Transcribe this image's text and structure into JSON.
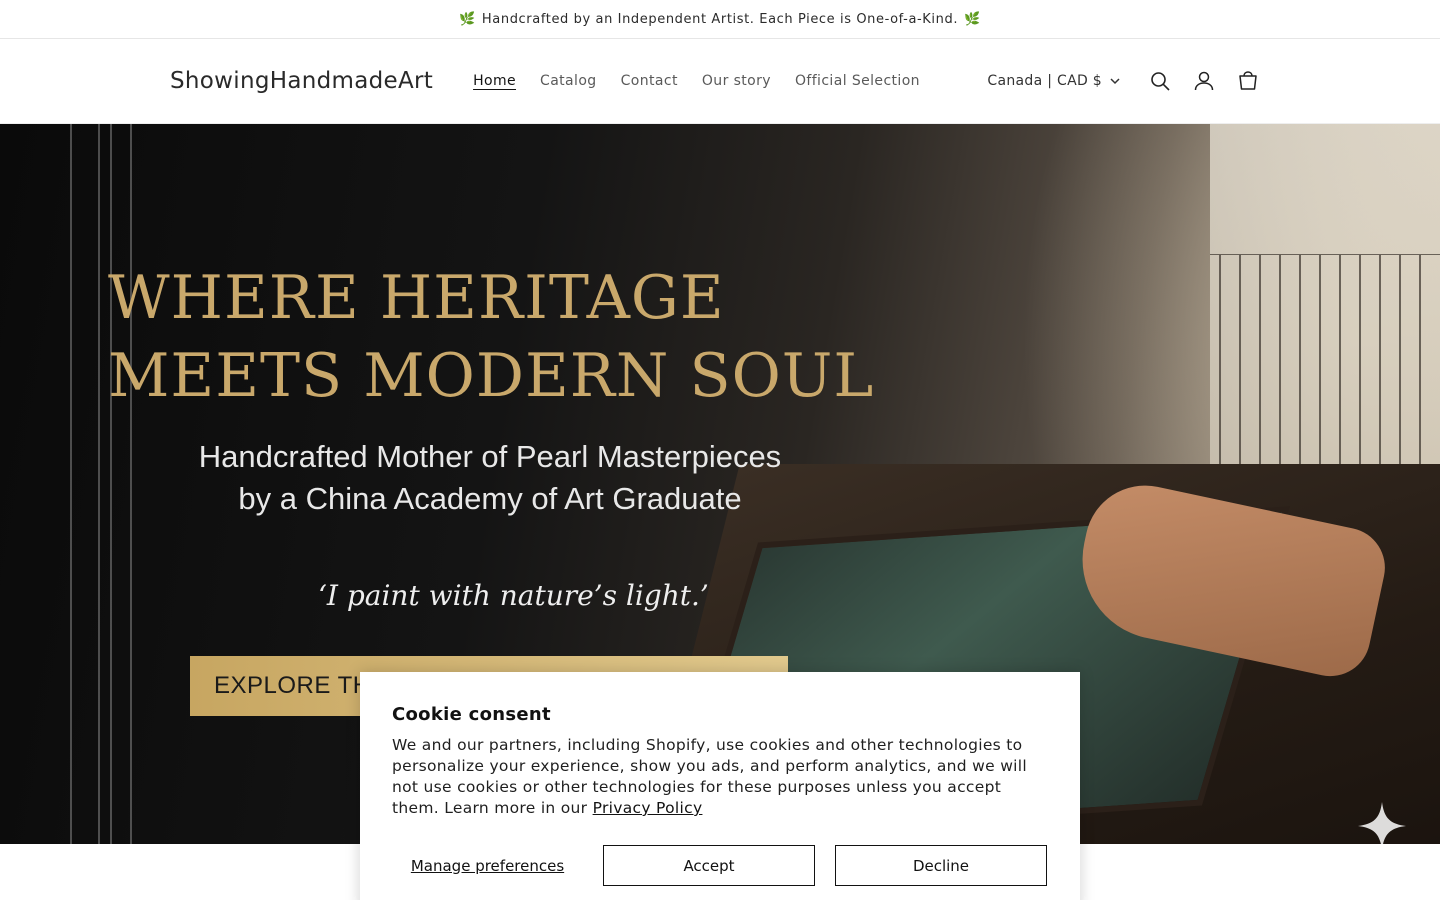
{
  "announcement": {
    "text": "Handcrafted by an Independent Artist. Each Piece is One-of-a-Kind.",
    "leaf_icon": "leaf-icon"
  },
  "header": {
    "logo": "ShowingHandmadeArt",
    "nav": [
      {
        "label": "Home",
        "active": true
      },
      {
        "label": "Catalog"
      },
      {
        "label": "Contact"
      },
      {
        "label": "Our story"
      },
      {
        "label": "Official Selection"
      }
    ],
    "country_selector": "Canada | CAD $",
    "icons": [
      "search-icon",
      "account-icon",
      "cart-icon"
    ]
  },
  "hero": {
    "title_line1": "WHERE HERITAGE",
    "title_line2": "MEETS MODERN SOUL",
    "subtitle_line1": "Handcrafted Mother of Pearl Masterpieces",
    "subtitle_line2": "by a China Academy of Art Graduate",
    "quote": "‘I paint with nature’s light.’",
    "cta_visible": "EXPLORE TH"
  },
  "cookie": {
    "title": "Cookie consent",
    "body": "We and our partners, including Shopify, use cookies and other technologies to personalize your experience, show you ads, and perform analytics, and we will not use cookies or other technologies for these purposes unless you accept them. Learn more in our",
    "link": "Privacy Policy",
    "manage": "Manage preferences",
    "accept": "Accept",
    "decline": "Decline"
  },
  "colors": {
    "hero_gold": "#c9a86b",
    "cta_gold": "#d4b676",
    "leaf_green": "#3c8a3c"
  }
}
